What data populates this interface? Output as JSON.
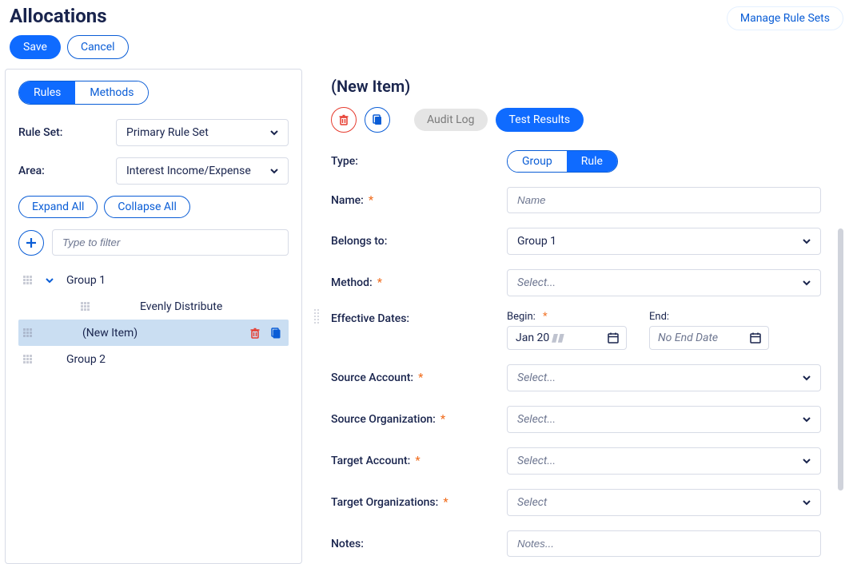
{
  "header": {
    "title": "Allocations",
    "manage_rule_sets": "Manage Rule Sets",
    "save": "Save",
    "cancel": "Cancel"
  },
  "left": {
    "tabs": {
      "rules": "Rules",
      "methods": "Methods"
    },
    "rule_set_label": "Rule Set:",
    "rule_set_value": "Primary Rule Set",
    "area_label": "Area:",
    "area_value": "Interest Income/Expense",
    "expand_all": "Expand All",
    "collapse_all": "Collapse All",
    "filter_placeholder": "Type to filter",
    "tree": {
      "group1": "Group 1",
      "evenly": "Evenly Distribute",
      "new_item": "(New Item)",
      "group2": "Group 2"
    }
  },
  "right": {
    "title": "(New Item)",
    "audit_log": "Audit Log",
    "test_results": "Test Results",
    "type_label": "Type:",
    "type_group": "Group",
    "type_rule": "Rule",
    "name_label": "Name:",
    "name_placeholder": "Name",
    "belongs_label": "Belongs to:",
    "belongs_value": "Group 1",
    "method_label": "Method:",
    "select_placeholder": "Select...",
    "select_plain": "Select",
    "eff_dates_label": "Effective Dates:",
    "begin_label": "Begin:",
    "end_label": "End:",
    "begin_value_prefix": "Jan 20",
    "end_placeholder": "No End Date",
    "source_account_label": "Source Account:",
    "source_org_label": "Source Organization:",
    "target_account_label": "Target Account:",
    "target_orgs_label": "Target Organizations:",
    "notes_label": "Notes:",
    "notes_placeholder": "Notes..."
  }
}
